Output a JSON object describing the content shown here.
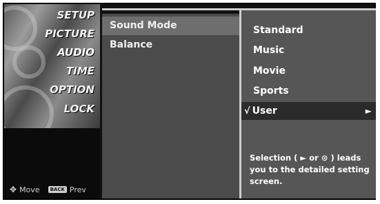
{
  "menu": {
    "items": [
      {
        "label": "SETUP"
      },
      {
        "label": "PICTURE"
      },
      {
        "label": "AUDIO"
      },
      {
        "label": "TIME"
      },
      {
        "label": "OPTION"
      },
      {
        "label": "LOCK"
      }
    ],
    "active": "AUDIO"
  },
  "footer": {
    "move_label": "Move",
    "back_badge": "BACK",
    "prev_label": "Prev"
  },
  "submenu": {
    "items": [
      {
        "label": "Sound Mode"
      },
      {
        "label": "Balance"
      }
    ],
    "selected": "Sound Mode"
  },
  "options": {
    "items": [
      {
        "label": "Standard"
      },
      {
        "label": "Music"
      },
      {
        "label": "Movie"
      },
      {
        "label": "Sports"
      },
      {
        "label": "User"
      }
    ],
    "current": "User",
    "check_glyph": "√",
    "arrow_glyph": "►"
  },
  "info": {
    "text": "Selection ( ► or ⊙ ) leads you to the detailed setting screen."
  }
}
